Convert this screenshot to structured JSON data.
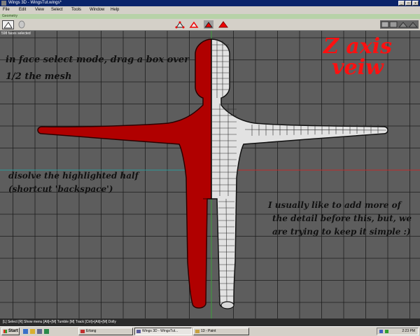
{
  "window": {
    "title": "Wings 3D - WingsTut.wings*",
    "buttons": [
      "_",
      "□",
      "x"
    ]
  },
  "menu": [
    "File",
    "Edit",
    "View",
    "Select",
    "Tools",
    "Window",
    "Help"
  ],
  "geometry_bar": {
    "label": "Geometry"
  },
  "toolbar": {
    "select_modes": [
      "vertex",
      "edge",
      "face",
      "body"
    ],
    "active_mode": "face"
  },
  "viewport": {
    "status": "598 faces selected",
    "heading": [
      "Z axis",
      "veiw"
    ],
    "annotation_1": [
      "in face select mode, drag a box over",
      "1/2 the mesh"
    ],
    "annotation_2": [
      "disolve the highlighted half",
      "(shortcut 'backspace')"
    ],
    "annotation_3": [
      "I usually like to add more of",
      "the detail before this, but, we",
      "are trying to keep it simple :)"
    ],
    "colors": {
      "background": "#5d5d5d",
      "grid": "#1e1e1e",
      "selected": "#b00000",
      "mesh": "#e2e2e2",
      "heading": "#ff1010"
    }
  },
  "help_bar": "[L] Select  [R] Show menu  [Alt]+[M] Tumble  [M] Track  [Ctrl]+[Alt]+[M] Dolly",
  "taskbar": {
    "start": "Start",
    "tasks": [
      {
        "label": "Erlang",
        "active": false
      },
      {
        "label": "Wings 3D - WingsTut...",
        "active": true
      },
      {
        "label": "13 - Paint",
        "active": false
      }
    ],
    "clock": "2:23 PM"
  }
}
